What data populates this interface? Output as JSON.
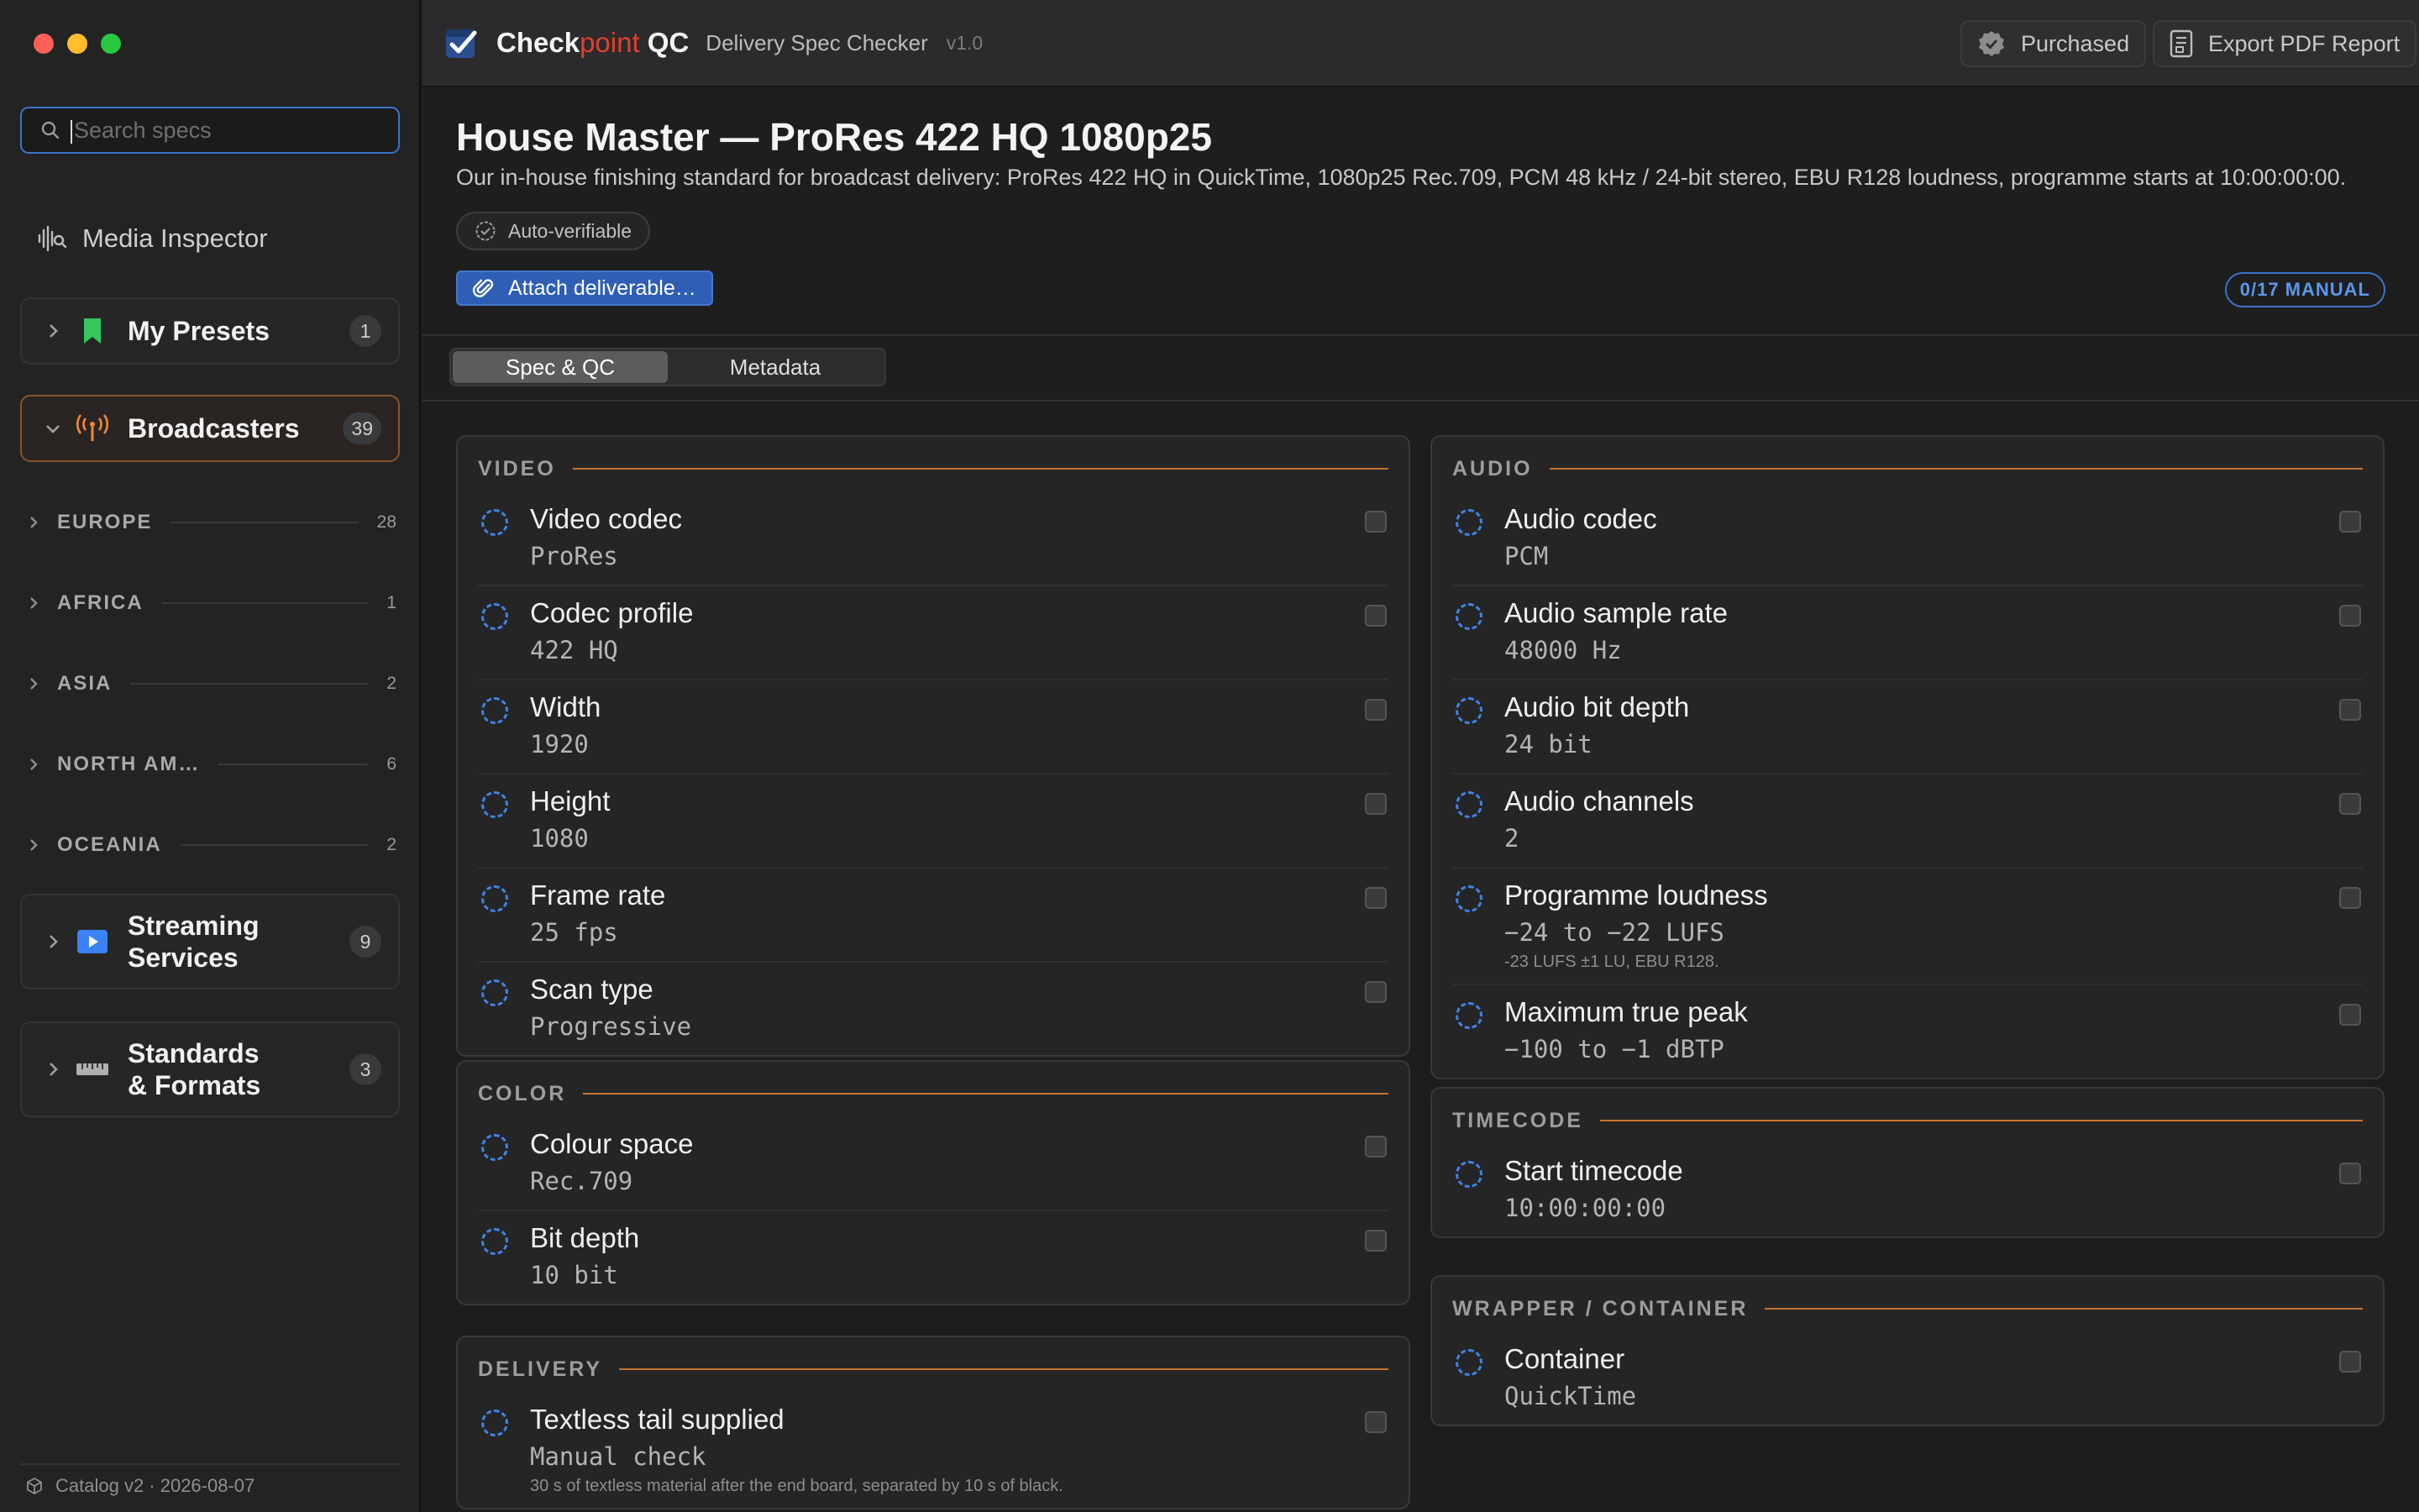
{
  "window": {
    "traffic_lights": {
      "close": "#fe5f57",
      "minimize": "#febc2e",
      "zoom": "#28c840"
    }
  },
  "sidebar": {
    "search": {
      "placeholder": "Search specs",
      "value": ""
    },
    "media_inspector": {
      "label": "Media Inspector",
      "icon": "waveform-search-icon"
    },
    "categories": {
      "my_presets": {
        "label": "My Presets",
        "count": "1",
        "icon": "bookmark-icon",
        "icon_color": "#34c759",
        "expanded": false
      },
      "broadcasters": {
        "label": "Broadcasters",
        "count": "39",
        "icon": "antenna-icon",
        "icon_color": "#f0883e",
        "expanded": true
      },
      "streaming": {
        "label_line1": "Streaming",
        "label_line2": "Services",
        "count": "9",
        "icon": "play-icon",
        "icon_color": "#3b82f6",
        "expanded": false
      },
      "standards": {
        "label_line1": "Standards",
        "label_line2": "& Formats",
        "count": "3",
        "icon": "ruler-icon",
        "icon_color": "#b0b0b3",
        "expanded": false
      }
    },
    "regions": [
      {
        "name": "EUROPE",
        "count": "28"
      },
      {
        "name": "AFRICA",
        "count": "1"
      },
      {
        "name": "ASIA",
        "count": "2"
      },
      {
        "name": "NORTH AM…",
        "count": "6"
      },
      {
        "name": "OCEANIA",
        "count": "2"
      }
    ],
    "footer": "Catalog v2 · 2026-08-07"
  },
  "toolbar": {
    "brand_main": "Check",
    "brand_accent": "point",
    "brand_suffix": " QC",
    "subtitle": "Delivery Spec Checker",
    "version": "v1.0",
    "purchased_label": "Purchased",
    "export_label": "Export PDF Report",
    "accent_color": "#e0402f"
  },
  "header": {
    "title": "House Master — ProRes 422 HQ 1080p25",
    "description": "Our in-house finishing standard for broadcast delivery: ProRes 422 HQ in QuickTime, 1080p25 Rec.709, PCM 48 kHz / 24-bit stereo, EBU R128 loudness, programme starts at 10:00:00:00.",
    "auto_chip": "Auto-verifiable",
    "attach_button": "Attach deliverable…",
    "manual_badge": "0/17 MANUAL"
  },
  "tabs": [
    {
      "label": "Spec & QC",
      "active": true
    },
    {
      "label": "Metadata",
      "active": false
    }
  ],
  "sections": {
    "video": {
      "title": "VIDEO",
      "rows": [
        {
          "label": "Video codec",
          "value": "ProRes"
        },
        {
          "label": "Codec profile",
          "value": "422 HQ"
        },
        {
          "label": "Width",
          "value": "1920"
        },
        {
          "label": "Height",
          "value": "1080"
        },
        {
          "label": "Frame rate",
          "value": "25 fps"
        },
        {
          "label": "Scan type",
          "value": "Progressive"
        }
      ]
    },
    "color": {
      "title": "COLOR",
      "rows": [
        {
          "label": "Colour space",
          "value": "Rec.709"
        },
        {
          "label": "Bit depth",
          "value": "10 bit"
        }
      ]
    },
    "delivery": {
      "title": "DELIVERY",
      "rows": [
        {
          "label": "Textless tail supplied",
          "value": "Manual check",
          "note": "30 s of textless material after the end board, separated by 10 s of black."
        }
      ]
    },
    "audio": {
      "title": "AUDIO",
      "rows": [
        {
          "label": "Audio codec",
          "value": "PCM"
        },
        {
          "label": "Audio sample rate",
          "value": "48000 Hz"
        },
        {
          "label": "Audio bit depth",
          "value": "24 bit"
        },
        {
          "label": "Audio channels",
          "value": "2"
        },
        {
          "label": "Programme loudness",
          "value": "−24 to −22 LUFS",
          "note": "-23 LUFS ±1 LU, EBU R128."
        },
        {
          "label": "Maximum true peak",
          "value": "−100 to −1 dBTP"
        }
      ]
    },
    "timecode": {
      "title": "TIMECODE",
      "rows": [
        {
          "label": "Start timecode",
          "value": "10:00:00:00"
        }
      ]
    },
    "wrapper": {
      "title": "WRAPPER / CONTAINER",
      "rows": [
        {
          "label": "Container",
          "value": "QuickTime"
        }
      ]
    }
  },
  "colors": {
    "section_rule": "#c7762f",
    "status_ring": "#3f83e6",
    "primary_button": "#2f5fb5"
  }
}
